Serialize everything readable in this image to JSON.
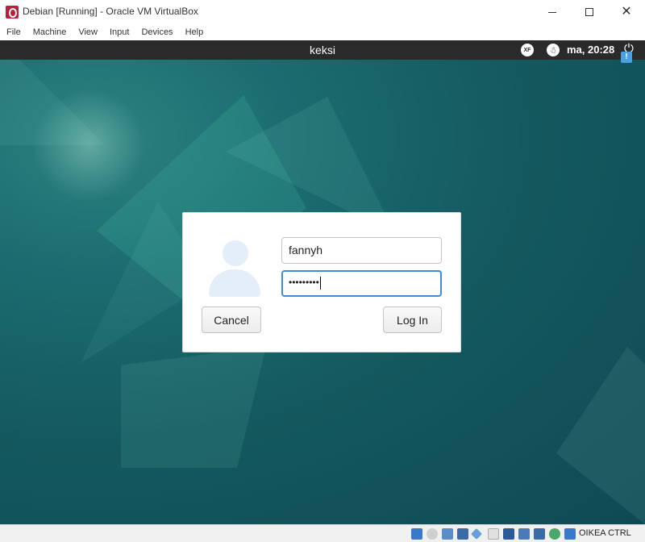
{
  "window": {
    "title": "Debian [Running] - Oracle VM VirtualBox",
    "controls": {
      "minimize": "minimize",
      "maximize": "maximize",
      "close": "✕"
    }
  },
  "menubar": {
    "items": [
      "File",
      "Machine",
      "View",
      "Input",
      "Devices",
      "Help"
    ]
  },
  "vm": {
    "panel": {
      "hostname": "keksi",
      "keyboard_indicator": "XF",
      "clock": "ma, 20:28"
    },
    "login": {
      "username": "fannyh",
      "password_mask": "•••••••••",
      "cancel_label": "Cancel",
      "login_label": "Log In"
    }
  },
  "statusbar": {
    "icons": [
      "hard-disk",
      "optical-drive",
      "audio",
      "network",
      "usb",
      "shared-folders",
      "display",
      "video-capture",
      "cpu",
      "mouse-integration",
      "keyboard-capture"
    ],
    "host_key": "OIKEA CTRL"
  },
  "colors": {
    "accent": "#3c8cd8",
    "panel": "#2a2a2a",
    "desktop": "#14595f"
  }
}
